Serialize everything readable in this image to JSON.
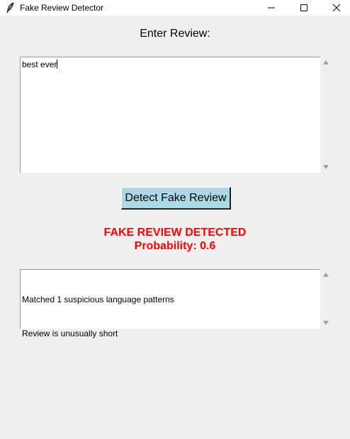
{
  "window": {
    "title": "Fake Review Detector"
  },
  "form": {
    "label": "Enter Review:",
    "review_text": "best ever",
    "button_label": "Detect Fake Review"
  },
  "result": {
    "verdict": "FAKE REVIEW DETECTED",
    "probability_text": "Probability: 0.6",
    "color": "#ff0000",
    "details": [
      "Matched 1 suspicious language patterns",
      "Review is unusually short"
    ]
  },
  "icons": {
    "app": "feather-icon",
    "minimize": "minimize-icon",
    "maximize": "maximize-icon",
    "close": "close-icon"
  }
}
